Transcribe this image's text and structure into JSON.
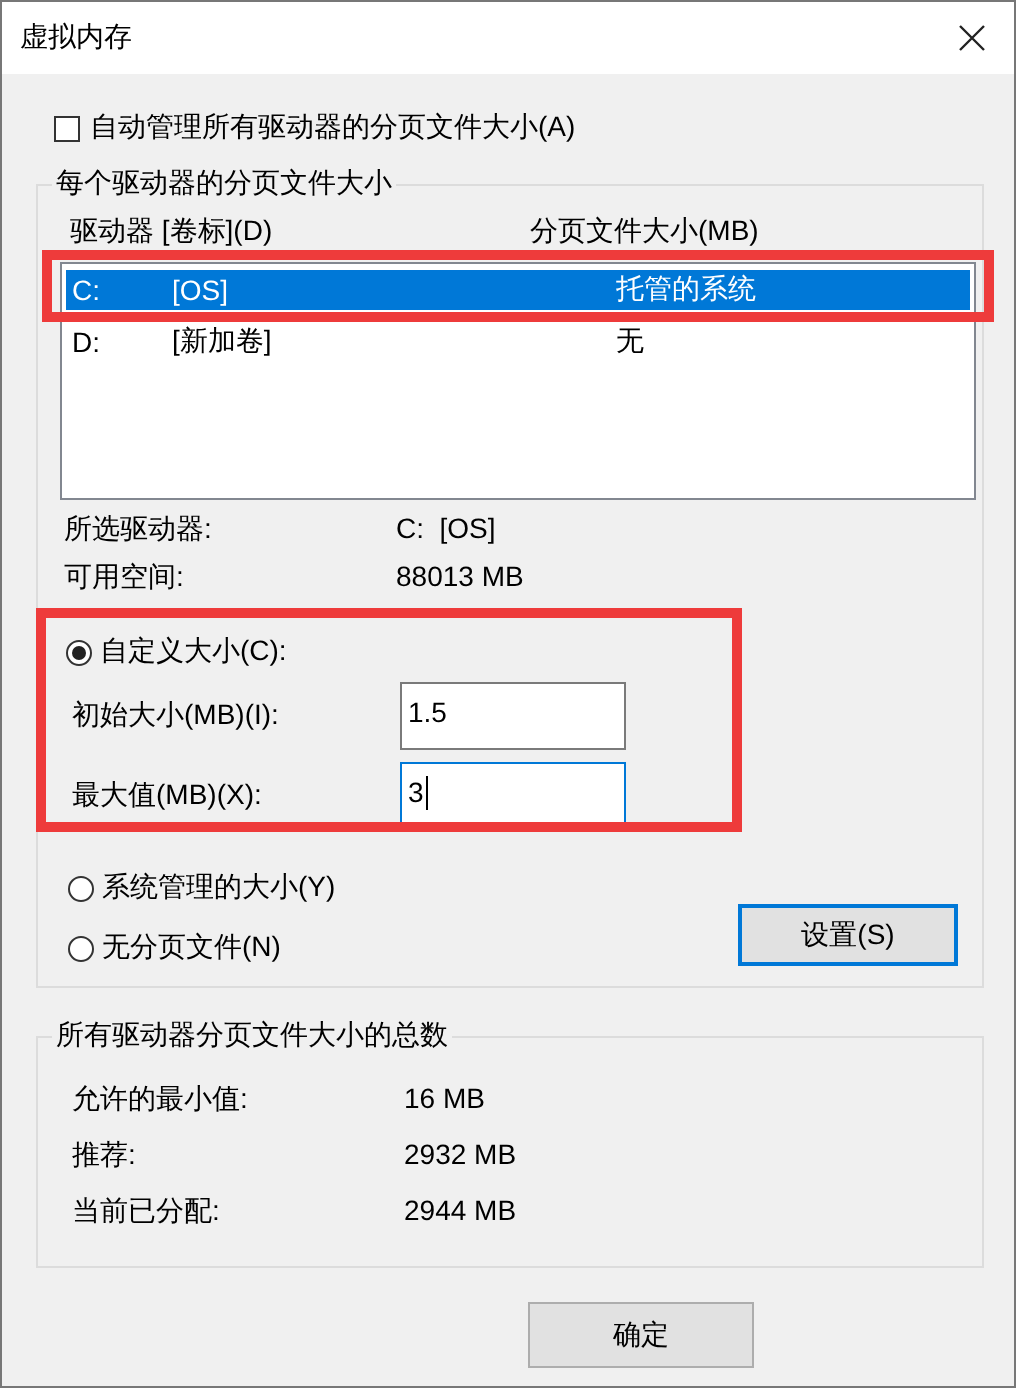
{
  "window": {
    "title": "虚拟内存"
  },
  "auto_manage": {
    "label": "自动管理所有驱动器的分页文件大小(A)",
    "checked": false
  },
  "drive_group": {
    "title": "每个驱动器的分页文件大小",
    "columns": [
      "驱动器 [卷标](D)",
      "分页文件大小(MB)"
    ],
    "drives": [
      {
        "drive": "C:",
        "volume": "[OS]",
        "size": "托管的系统",
        "selected": true
      },
      {
        "drive": "D:",
        "volume": "[新加卷]",
        "size": "无",
        "selected": false
      }
    ],
    "info": [
      {
        "label": "所选驱动器:",
        "value": "C:  [OS]"
      },
      {
        "label": "可用空间:",
        "value": "88013 MB"
      }
    ],
    "size_options": [
      {
        "label": "自定义大小(C):",
        "selected": true
      },
      {
        "label": "系统管理的大小(Y)",
        "selected": false
      },
      {
        "label": "无分页文件(N)",
        "selected": false
      }
    ],
    "fields": [
      {
        "label": "初始大小(MB)(I):",
        "value": "1.5",
        "focused": false
      },
      {
        "label": "最大值(MB)(X):",
        "value": "3",
        "focused": true
      }
    ],
    "set_button": "设置(S)"
  },
  "totals": {
    "title": "所有驱动器分页文件大小的总数",
    "rows": [
      {
        "label": "允许的最小值:",
        "value": "16 MB"
      },
      {
        "label": "推荐:",
        "value": "2932 MB"
      },
      {
        "label": "当前已分配:",
        "value": "2944 MB"
      }
    ]
  },
  "buttons": [
    "确定"
  ]
}
